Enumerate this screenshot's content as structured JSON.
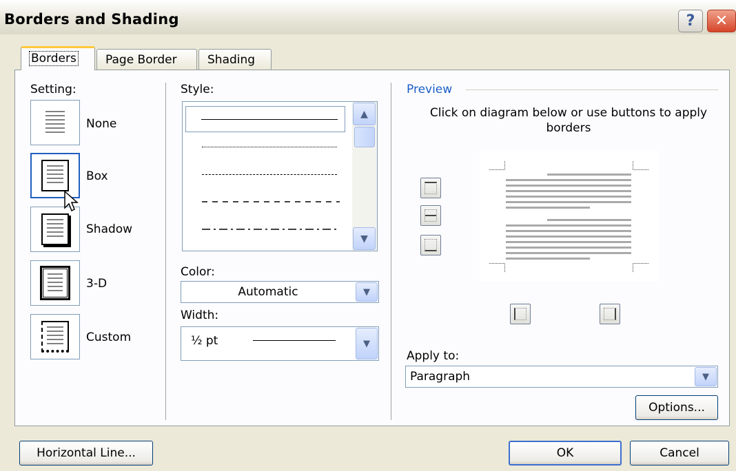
{
  "window": {
    "title": "Borders and Shading",
    "help_glyph": "?",
    "close_glyph": "✕"
  },
  "tabs": [
    {
      "label": "Borders",
      "active": true
    },
    {
      "label": "Page Border",
      "active": false
    },
    {
      "label": "Shading",
      "active": false
    }
  ],
  "setting": {
    "label": "Setting:",
    "items": [
      {
        "label": "None",
        "icon": "no-border-icon"
      },
      {
        "label": "Box",
        "icon": "box-border-icon"
      },
      {
        "label": "Shadow",
        "icon": "shadow-border-icon"
      },
      {
        "label": "3-D",
        "icon": "3d-border-icon"
      },
      {
        "label": "Custom",
        "icon": "custom-border-icon"
      }
    ]
  },
  "style": {
    "label": "Style:",
    "items": [
      "solid",
      "dotted",
      "dashed-short",
      "dashed-long",
      "dash-dot"
    ]
  },
  "color": {
    "label": "Color:",
    "value": "Automatic"
  },
  "width": {
    "label": "Width:",
    "value": "½ pt"
  },
  "preview": {
    "title": "Preview",
    "instruction": "Click on diagram below or use buttons to apply borders"
  },
  "apply_to": {
    "label": "Apply to:",
    "value": "Paragraph"
  },
  "buttons": {
    "options": "Options...",
    "horizontal_line": "Horizontal Line...",
    "ok": "OK",
    "cancel": "Cancel"
  },
  "colors": {
    "accent_blue": "#1c5fc7",
    "tab_highlight": "#ffc83c",
    "dialog_bg": "#ece9d8"
  }
}
